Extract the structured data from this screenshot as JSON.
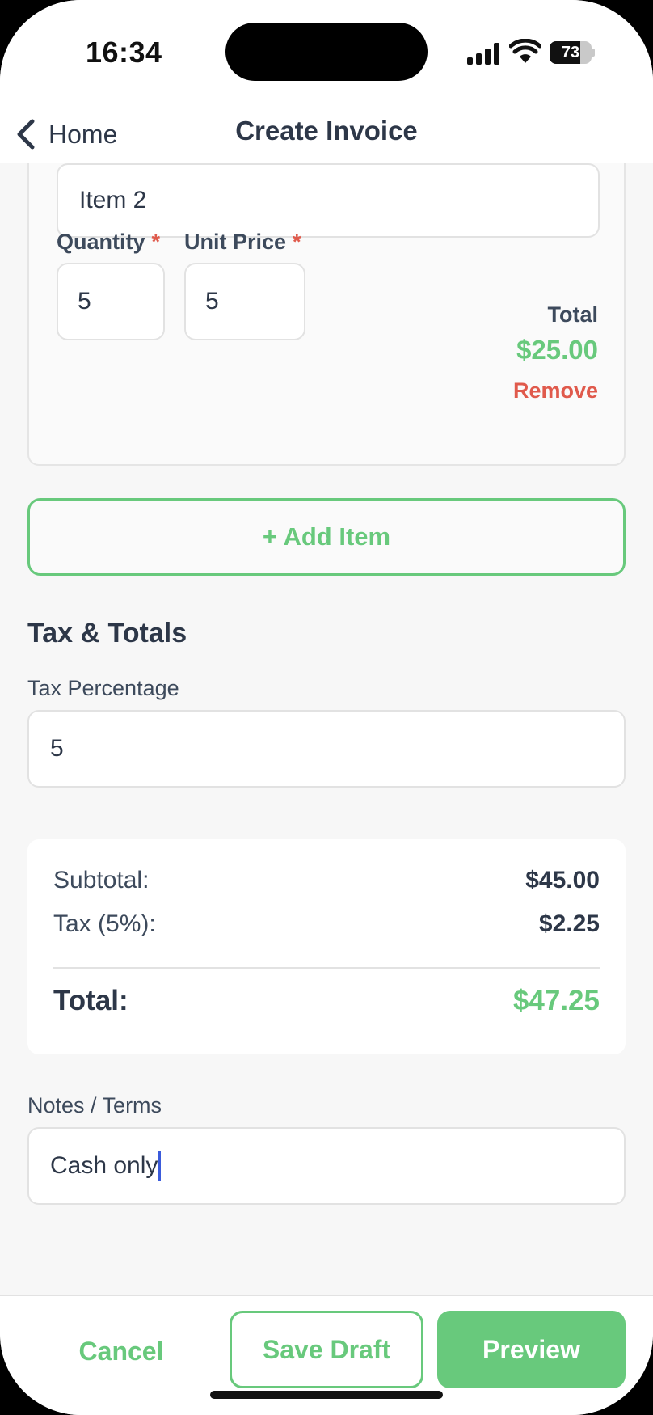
{
  "status_bar": {
    "time": "16:34",
    "battery_percent": "73",
    "battery_level": 0.73,
    "icons": [
      "signal-icon",
      "wifi-icon",
      "battery-icon"
    ]
  },
  "nav": {
    "back_label": "Home",
    "title": "Create Invoice"
  },
  "line_item": {
    "name": "Item 2",
    "quantity_label": "Quantity",
    "unit_price_label": "Unit Price",
    "required_mark": "*",
    "quantity": "5",
    "unit_price": "5",
    "total_label": "Total",
    "total": "$25.00",
    "remove_label": "Remove"
  },
  "add_item_label": "+ Add Item",
  "tax_section": {
    "title": "Tax & Totals",
    "tax_label": "Tax Percentage",
    "tax_value": "5"
  },
  "summary": {
    "subtotal_label": "Subtotal:",
    "subtotal": "$45.00",
    "tax_label": "Tax (5%):",
    "tax": "$2.25",
    "total_label": "Total:",
    "total": "$47.25"
  },
  "notes": {
    "label": "Notes / Terms",
    "value": "Cash only"
  },
  "actions": {
    "cancel": "Cancel",
    "save_draft": "Save Draft",
    "preview": "Preview"
  },
  "colors": {
    "accent_green": "#68c97c",
    "danger_red": "#e05a4c",
    "text_dark": "#2d3748",
    "caret_blue": "#3b5bdb"
  }
}
